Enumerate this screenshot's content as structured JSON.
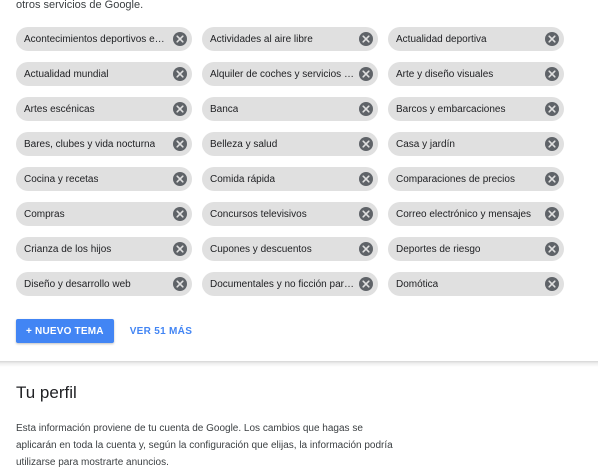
{
  "intro_text": "otros servicios de Google.",
  "topics": [
    "Acontecimientos deportivos en dire...",
    "Actividades al aire libre",
    "Actualidad deportiva",
    "Actualidad mundial",
    "Alquiler de coches y servicios de taxi",
    "Arte y diseño visuales",
    "Artes escénicas",
    "Banca",
    "Barcos y embarcaciones",
    "Bares, clubes y vida nocturna",
    "Belleza y salud",
    "Casa y jardín",
    "Cocina y recetas",
    "Comida rápida",
    "Comparaciones de precios",
    "Compras",
    "Concursos televisivos",
    "Correo electrónico y mensajes",
    "Crianza de los hijos",
    "Cupones y descuentos",
    "Deportes de riesgo",
    "Diseño y desarrollo web",
    "Documentales y no ficción para tele...",
    "Domótica"
  ],
  "actions": {
    "new_topic_label": "+ NUEVO TEMA",
    "see_more_label": "VER 51 MÁS"
  },
  "profile": {
    "title": "Tu perfil",
    "description": "Esta información proviene de tu cuenta de Google. Los cambios que hagas se aplicarán en toda la cuenta y, según la configuración que elijas, la información podría utilizarse para mostrarte anuncios."
  },
  "colors": {
    "accent": "#4285f4",
    "chip_background": "#e0e0e0",
    "remove_icon": "#5f6368"
  },
  "icons": {
    "chip_remove": "close-circle-icon"
  }
}
